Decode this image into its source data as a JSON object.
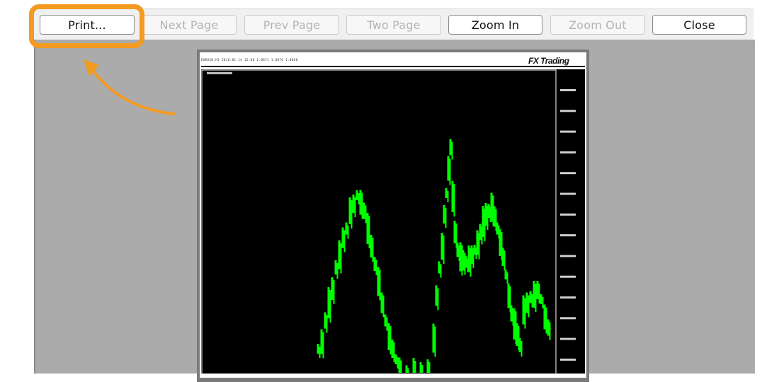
{
  "toolbar": {
    "buttons": [
      {
        "label": "Print...",
        "enabled": true
      },
      {
        "label": "Next Page",
        "enabled": false
      },
      {
        "label": "Prev Page",
        "enabled": false
      },
      {
        "label": "Two Page",
        "enabled": false
      },
      {
        "label": "Zoom In",
        "enabled": true
      },
      {
        "label": "Zoom Out",
        "enabled": false
      },
      {
        "label": "Close",
        "enabled": true
      }
    ]
  },
  "page": {
    "header_text": "EURUSD,H1 2016.01.14 12:00 1.0871 1.0876 1.0868",
    "brand_logo": "FX Trading"
  },
  "chart": {
    "background": "#000000",
    "bar_color": "#00ff00",
    "axis_text_color": "#cfcfcf"
  },
  "annotation": {
    "highlight_color": "#f39a21",
    "target": "print-button"
  }
}
